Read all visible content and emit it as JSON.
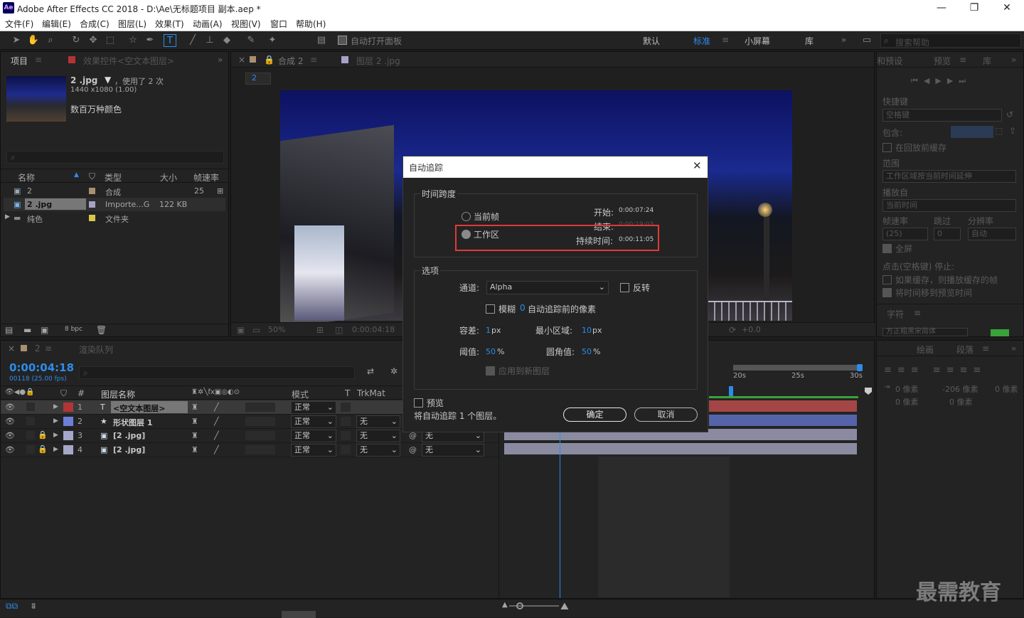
{
  "title_bar": {
    "app_title": "Adobe After Effects CC 2018 - D:\\Ae\\无标题项目 副本.aep *",
    "logo": "Ae",
    "min": "—",
    "max": "❐",
    "close": "✕"
  },
  "menu": [
    "文件(F)",
    "编辑(E)",
    "合成(C)",
    "图层(L)",
    "效果(T)",
    "动画(A)",
    "视图(V)",
    "窗口",
    "帮助(H)"
  ],
  "toolbar": {
    "auto_open_label": "自动打开面板",
    "workspaces": [
      "默认",
      "标准",
      "小屏幕",
      "库"
    ],
    "search_placeholder": "搜索帮助"
  },
  "project": {
    "tab": "项目",
    "effects_tab": "效果控件<空文本图层>",
    "asset_name": "2 .jpg",
    "used": "，使用了 2 次",
    "dims": "1440 x1080 (1.00)",
    "colors": "数百万种颜色",
    "columns": [
      "名称",
      "类型",
      "大小",
      "帧速率"
    ],
    "rows": [
      {
        "name": "2",
        "type": "合成",
        "size": "",
        "fps": "25"
      },
      {
        "name": "2 .jpg",
        "type": "Importe...G",
        "size": "122 KB",
        "fps": ""
      },
      {
        "name": "纯色",
        "type": "文件夹",
        "size": "",
        "fps": ""
      }
    ],
    "bpc": "8 bpc"
  },
  "comp": {
    "tab": "合成 2",
    "layer_tab": "图层 2 .jpg",
    "crumb": "2",
    "zoom": "50%",
    "time": "0:00:04:18",
    "exposure": "+0.0"
  },
  "preview": {
    "tab": "预览",
    "lib": "库",
    "presets_partial": "和预设",
    "shortcut_label": "快捷键",
    "shortcut_val": "空格键",
    "include": "包含:",
    "cache_before": "在回放前缓存",
    "range_label": "范围",
    "range_val": "工作区域按当前时间延伸",
    "play_from": "播放自",
    "play_from_val": "当前时间",
    "fps_label": "帧速率",
    "skip": "跳过",
    "res": "分辨率",
    "fps_val": "(25)",
    "skip_val": "0",
    "res_val": "自动",
    "fullscreen": "全屏",
    "stop_note": "点击(空格键) 停止:",
    "if_cached": "如果缓存，则播放缓存的帧",
    "move_time": "将时间移到预览时间",
    "char_tab": "字符",
    "font_val": "方正粗黑宋简体"
  },
  "paragraph": {
    "tab1": "绘画",
    "tab2": "段落",
    "v1": "0 像素",
    "v2": "-206 像素",
    "v3": "0 像素",
    "v4": "0 像素",
    "v5": "0 像素"
  },
  "timeline": {
    "tab": "2",
    "render_queue": "渲染队列",
    "timecode": "0:00:04:18",
    "fps_note": "00118 (25.00 fps)",
    "columns": {
      "num": "#",
      "name": "图层名称",
      "mode": "模式",
      "t": "T",
      "trk": "TrkMat"
    },
    "layers": [
      {
        "n": "1",
        "name": "<空文本图层>",
        "mode": "正常",
        "trk": "",
        "parent": "",
        "color": "#b03636",
        "type": "T"
      },
      {
        "n": "2",
        "name": "形状图层 1",
        "mode": "正常",
        "trk": "无",
        "parent": "",
        "color": "#6d7fd9",
        "type": "★"
      },
      {
        "n": "3",
        "name": "[2 .jpg]",
        "mode": "正常",
        "trk": "无",
        "parent": "无",
        "color": "#a5a7c9",
        "type": "▣"
      },
      {
        "n": "4",
        "name": "[2 .jpg]",
        "mode": "正常",
        "trk": "无",
        "parent": "无",
        "color": "#a5a7c9",
        "type": "▣"
      }
    ],
    "ruler": [
      "20s",
      "25s",
      "30s"
    ]
  },
  "dialog": {
    "title": "自动追踪",
    "close": "✕",
    "time_span": "时间跨度",
    "current_frame": "当前帧",
    "work_area": "工作区",
    "start_label": "开始:",
    "start_val": "0:00:07:24",
    "end_label": "结束:",
    "end_val": "0:00:19:03",
    "duration_label": "持续时间:",
    "duration_val": "0:00:11:05",
    "options": "选项",
    "channel_label": "通道:",
    "channel_val": "Alpha",
    "invert": "反转",
    "blur": "模糊",
    "blur_val": "0",
    "blur_suffix": "自动追踪前的像素",
    "tolerance_label": "容差:",
    "tolerance_val": "1",
    "tolerance_unit": "px",
    "min_area_label": "最小区域:",
    "min_area_val": "10",
    "min_area_unit": "px",
    "threshold_label": "阈值:",
    "threshold_val": "50",
    "threshold_unit": "%",
    "corner_label": "圆角值:",
    "corner_val": "50",
    "corner_unit": "%",
    "apply_new": "应用到新图层",
    "preview": "预览",
    "status": "将自动追踪 1 个图层。",
    "ok": "确定",
    "cancel": "取消"
  },
  "watermark": "最需教育",
  "colors": {
    "accent": "#2d8ceb",
    "highlight_box": "#e03a3a",
    "playhead": "#2d8ceb"
  }
}
